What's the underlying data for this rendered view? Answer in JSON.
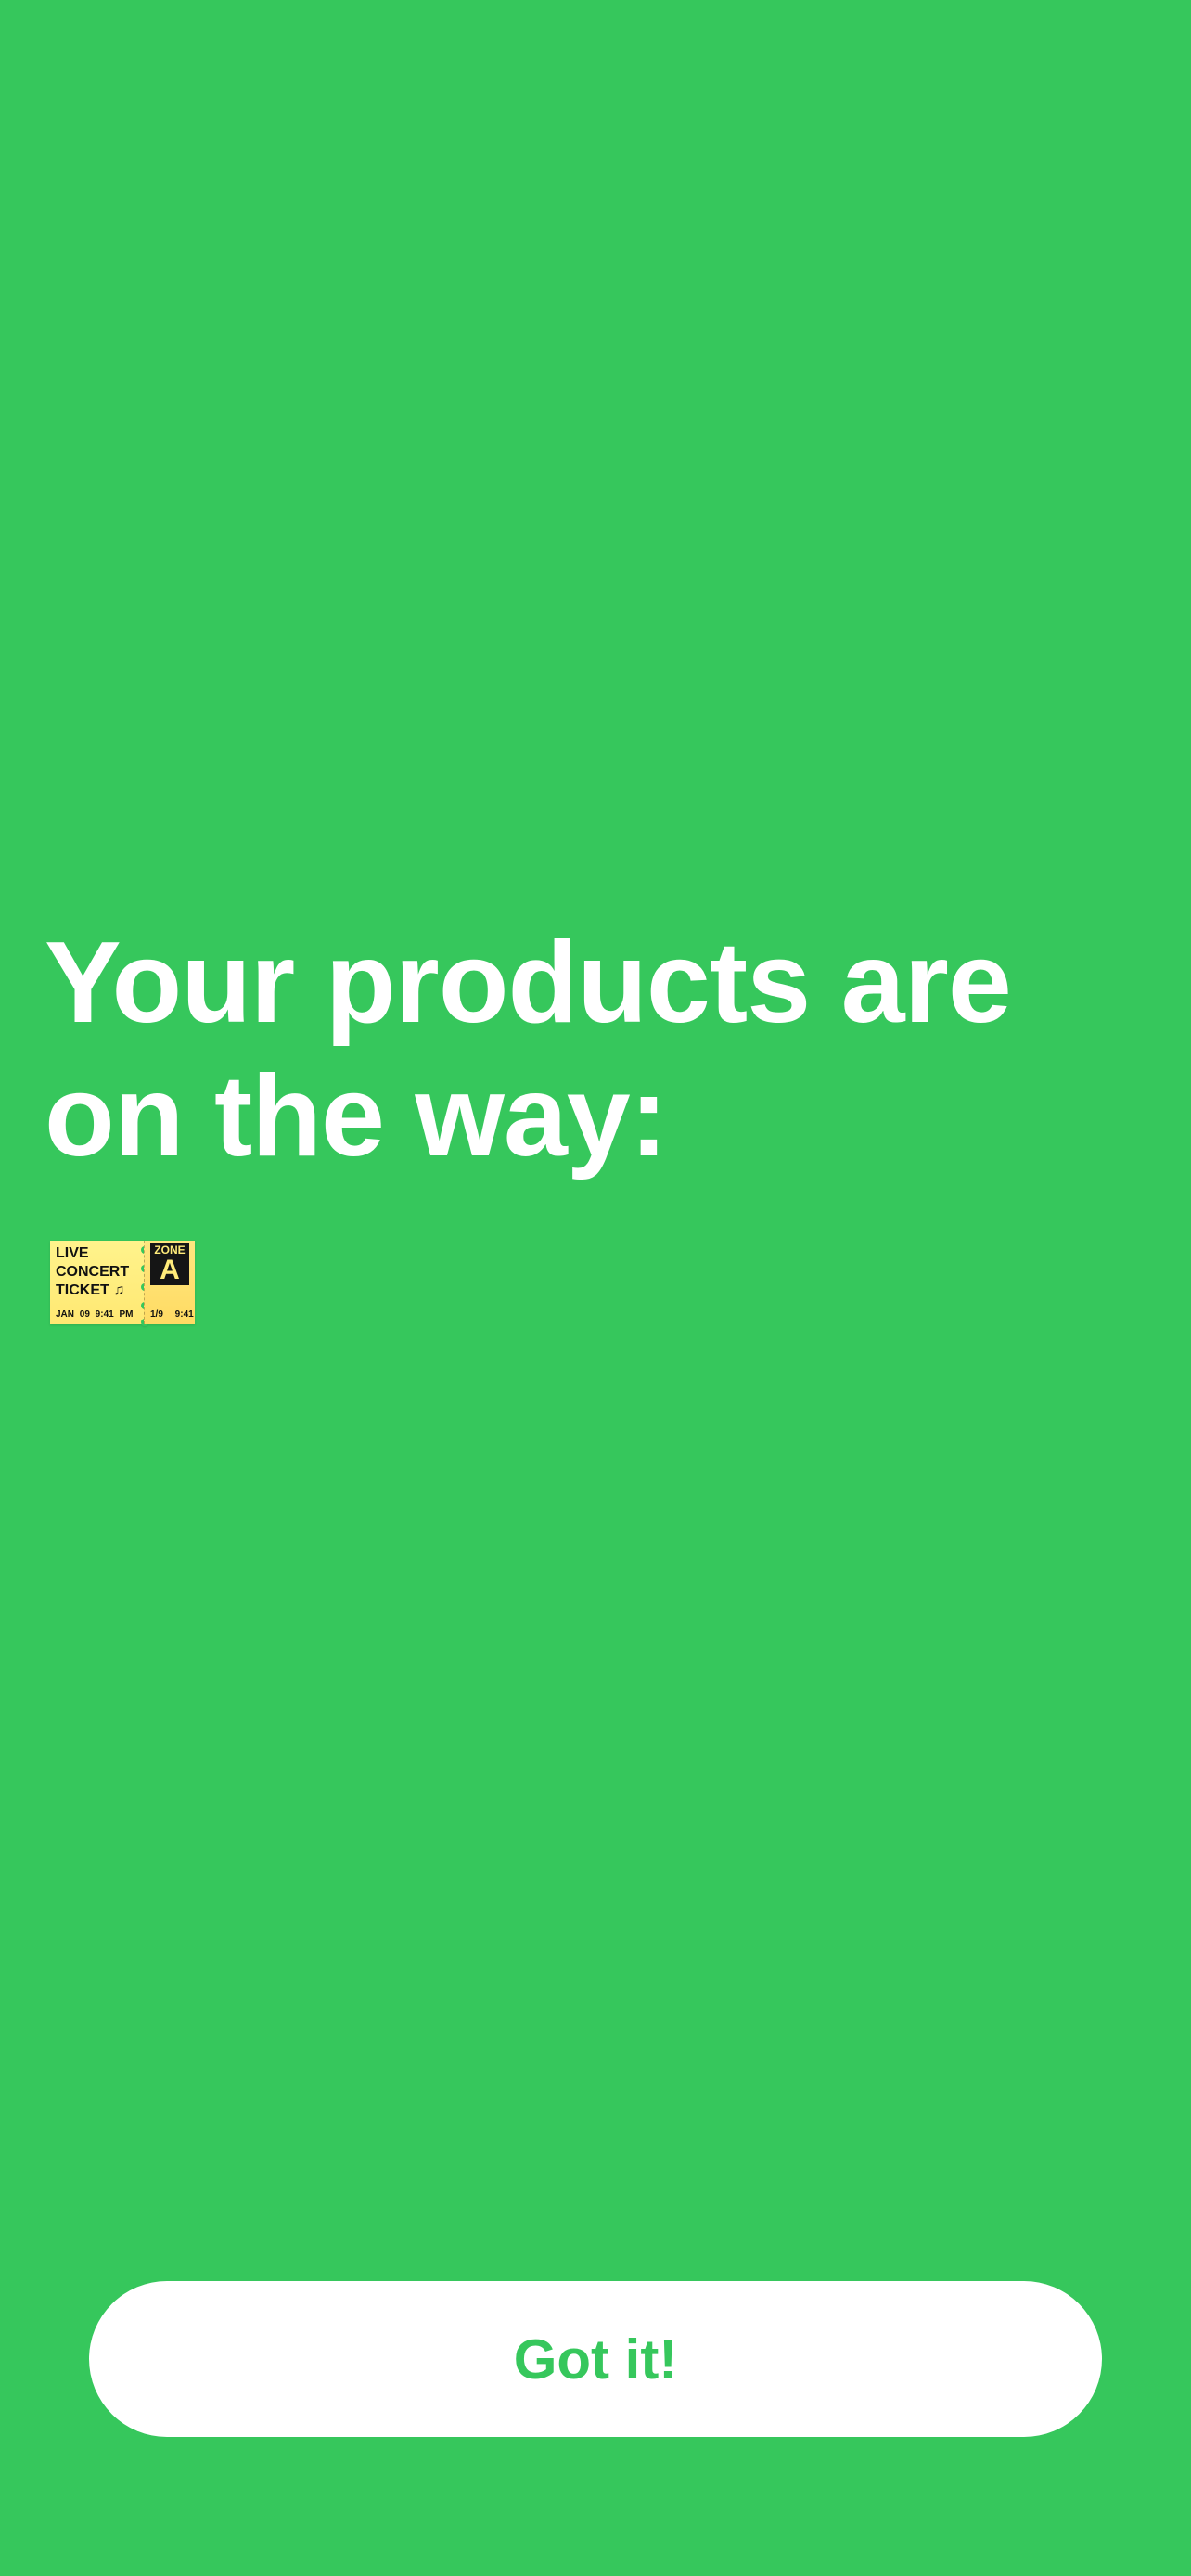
{
  "colors": {
    "background": "#36C75C",
    "headline_text": "#FFFFFF",
    "button_background": "#FFFFFF",
    "button_text": "#36C75C",
    "ticket_main": "#FFF38C",
    "ticket_stub": "#FFDB63",
    "zone_box": "#151515"
  },
  "headline": "Your products are on the way:",
  "products": [
    {
      "icon": "concert-ticket-icon",
      "title_lines": [
        "LIVE",
        "CONCERT",
        "TICKET ♫"
      ],
      "date_time": "JAN 09  9:41 PM",
      "zone_label": "ZONE",
      "zone_letter": "A",
      "stub_footer": "1/9  9:41"
    }
  ],
  "button": {
    "label": "Got it!"
  }
}
